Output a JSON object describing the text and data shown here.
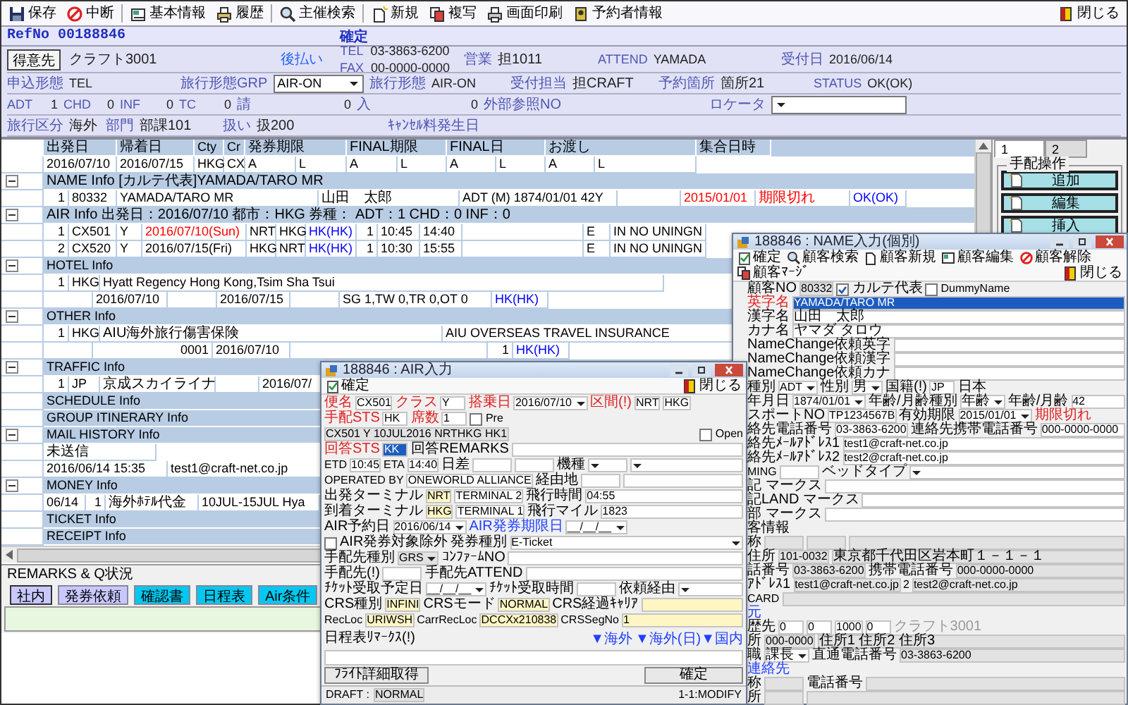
{
  "toolbar": {
    "items": [
      "保存",
      "中断",
      "基本情報",
      "履歴",
      "主催検索",
      "新規",
      "複写",
      "画面印刷",
      "予約者情報"
    ],
    "close": "閉じる"
  },
  "ref": {
    "label": "RefNo",
    "number": "00188846",
    "status": "確定"
  },
  "header": [
    [
      {
        "kind": "button",
        "text": "得意先"
      },
      {
        "kind": "value",
        "text": "クラフト3001"
      },
      {
        "kind": "link",
        "text": "後払い"
      },
      {
        "kind": "stack",
        "lines": [
          {
            "label": "TEL",
            "value": "03-3863-6200"
          },
          {
            "label": "FAX",
            "value": "00-0000-0000"
          }
        ]
      },
      {
        "kind": "field",
        "label": "営業",
        "value": "担1011"
      },
      {
        "kind": "field",
        "label": "ATTEND",
        "value": "YAMADA"
      },
      {
        "kind": "field",
        "label": "受付日",
        "value": "2016/06/14"
      }
    ],
    [
      {
        "kind": "field",
        "label": "申込形態",
        "value": "TEL"
      },
      {
        "kind": "select",
        "label": "旅行形態GRP",
        "value": "AIR-ON"
      },
      {
        "kind": "field",
        "label": "旅行形態",
        "value": "AIR-ON"
      },
      {
        "kind": "field",
        "label": "受付担当",
        "value": "担CRAFT"
      },
      {
        "kind": "field",
        "label": "予約箇所",
        "value": "箇所21"
      },
      {
        "kind": "field",
        "label": "STATUS",
        "value": "OK(OK)"
      }
    ],
    [
      {
        "kind": "count",
        "label": "ADT",
        "value": "1"
      },
      {
        "kind": "count",
        "label": "CHD",
        "value": "0"
      },
      {
        "kind": "count",
        "label": "INF",
        "value": "0"
      },
      {
        "kind": "count",
        "label": "TC",
        "value": "0"
      },
      {
        "kind": "count",
        "label": "請",
        "value": "0"
      },
      {
        "kind": "count",
        "label": "入",
        "value": "0"
      },
      {
        "kind": "label",
        "text": "外部参照NO"
      },
      {
        "kind": "select",
        "label": "ロケータ"
      }
    ],
    [
      {
        "kind": "field",
        "label": "旅行区分",
        "value": "海外"
      },
      {
        "kind": "field",
        "label": "部門",
        "value": "部課101"
      },
      {
        "kind": "field",
        "label": "扱い",
        "value": "扱200"
      },
      {
        "kind": "label",
        "text": "ｷｬﾝｾﾙ料発生日"
      }
    ]
  ],
  "grid": {
    "columns": [
      "出発日",
      "帰着日",
      "Cty",
      "Cr",
      "発券期限",
      "FINAL期限",
      "FINAL日",
      "お渡し",
      "集合日時"
    ],
    "rows": [
      {
        "kind": "dates",
        "cells": [
          "2016/07/10",
          "2016/07/15",
          "HKG",
          "CX",
          "A",
          "L",
          "A",
          "L",
          "A",
          "L",
          "A",
          "L"
        ]
      },
      {
        "kind": "section",
        "expanded": true,
        "text": "NAME Info [カルテ代表]YAMADA/TARO MR"
      },
      {
        "kind": "name",
        "cells": [
          "1",
          "80332",
          "YAMADA/TARO MR",
          "山田　太郎",
          "ADT (M) 1874/01/01 42Y",
          {
            "text": "2015/01/01",
            "color": "#ff0000"
          },
          {
            "text": "期限切れ",
            "color": "#ff0000"
          },
          {
            "text": "OK(OK)",
            "color": "#0000ff"
          }
        ]
      },
      {
        "kind": "section",
        "expanded": true,
        "text": "AIR Info 出発日：2016/07/10 都市：HKG 券種： ADT：1 CHD：0 INF：0"
      },
      {
        "kind": "flight",
        "cells": [
          "1",
          "CX501",
          "Y",
          {
            "text": "2016/07/10(Sun)",
            "color": "#ff0000"
          },
          "NRT",
          "HKG",
          {
            "text": "HK(HK)",
            "color": "#0000ff"
          },
          "1",
          "10:45",
          "14:40",
          "E",
          "IN NO UNINGN"
        ]
      },
      {
        "kind": "flight",
        "cells": [
          "2",
          "CX520",
          "Y",
          "2016/07/15(Fri)",
          "HKG",
          "NRT",
          {
            "text": "HK(HK)",
            "color": "#0000ff"
          },
          "1",
          "10:30",
          "15:55",
          "E",
          "IN NO UNINGN"
        ]
      },
      {
        "kind": "section",
        "expanded": true,
        "text": "HOTEL Info"
      },
      {
        "kind": "hotelA",
        "cells": [
          "1",
          "HKG",
          "Hyatt Regency Hong Kong,Tsim Sha Tsui"
        ]
      },
      {
        "kind": "hotelB",
        "cells": [
          "2016/07/10",
          "2016/07/15",
          "SG 1,TW 0,TR 0,OT 0",
          {
            "text": "HK(HK)",
            "color": "#0000ff"
          }
        ]
      },
      {
        "kind": "section",
        "expanded": true,
        "text": "OTHER Info"
      },
      {
        "kind": "otherA",
        "cells": [
          "1",
          "HKG",
          "AIU海外旅行傷害保険",
          "AIU OVERSEAS TRAVEL INSURANCE"
        ]
      },
      {
        "kind": "otherB",
        "cells": [
          "0001",
          "2016/07/10",
          "1",
          {
            "text": "HK(HK)",
            "color": "#0000ff"
          }
        ]
      },
      {
        "kind": "section",
        "expanded": true,
        "text": "TRAFFIC Info"
      },
      {
        "kind": "traffic",
        "cells": [
          "1",
          "JP",
          "京成スカイライナ",
          "2016/07/"
        ]
      },
      {
        "kind": "section",
        "text": "SCHEDULE Info"
      },
      {
        "kind": "section",
        "text": "GROUP ITINERARY Info"
      },
      {
        "kind": "section",
        "expanded": true,
        "text": "MAIL HISTORY Info"
      },
      {
        "kind": "mail",
        "cells": [
          "未送信"
        ]
      },
      {
        "kind": "mail2",
        "cells": [
          "2016/06/14 15:35",
          "test1@craft-net.co.jp"
        ]
      },
      {
        "kind": "section",
        "expanded": true,
        "text": "MONEY Info"
      },
      {
        "kind": "money",
        "cells": [
          "06/14",
          "1",
          "海外ﾎﾃﾙ代金",
          "10JUL-15JUL Hya"
        ]
      },
      {
        "kind": "section",
        "text": "TICKET Info"
      },
      {
        "kind": "section",
        "text": "RECEIPT Info"
      }
    ]
  },
  "remarks": {
    "title": "REMARKS & Q状況",
    "tabs": [
      {
        "label": "社内",
        "selected": true,
        "color": "#c8c8ff"
      },
      {
        "label": "発券依頼",
        "selected": false,
        "color": "#c8c8ff"
      },
      {
        "label": "確認書",
        "selected": false,
        "color": "#00c8f0"
      },
      {
        "label": "日程表",
        "selected": false,
        "color": "#00c8f0"
      },
      {
        "label": "Air条件",
        "selected": false,
        "color": "#00c8f0"
      }
    ]
  },
  "side": {
    "tabs": [
      {
        "label": "1",
        "selected": true
      },
      {
        "label": "2",
        "selected": false
      }
    ],
    "group": "手配操作",
    "buttons": [
      "追加",
      "編集",
      "挿入"
    ]
  },
  "name_dialog": {
    "title": "188846 : NAME入力(個別)",
    "toolbar": [
      "確定",
      "顧客検索",
      "顧客新規",
      "顧客編集",
      "顧客解除",
      "顧客ﾏｰｼﾞ"
    ],
    "close": "閉じる",
    "rows": [
      {
        "items": [
          {
            "kind": "label",
            "text": "顧客NO"
          },
          {
            "kind": "field",
            "value": "80332",
            "readonly": true
          },
          {
            "kind": "check",
            "text": "カルテ代表",
            "checked": true
          },
          {
            "kind": "check",
            "text": "DummyName",
            "checked": false
          }
        ]
      },
      {
        "items": [
          {
            "kind": "label",
            "text": "英字名",
            "color": "#e02020"
          },
          {
            "kind": "field",
            "value": "YAMADA/TARO MR",
            "highlighted": true
          }
        ]
      },
      {
        "items": [
          {
            "kind": "label",
            "text": "漢字名"
          },
          {
            "kind": "field",
            "value": "山田　太郎"
          }
        ]
      },
      {
        "items": [
          {
            "kind": "label",
            "text": "カナ名"
          },
          {
            "kind": "field",
            "value": "ヤマダ タロウ"
          }
        ]
      },
      {
        "items": [
          {
            "kind": "label",
            "text": "NameChange依頼英字"
          },
          {
            "kind": "field"
          }
        ]
      },
      {
        "items": [
          {
            "kind": "label",
            "text": "NameChange依頼漢字"
          },
          {
            "kind": "field"
          }
        ]
      },
      {
        "items": [
          {
            "kind": "label",
            "text": "NameChange依頼カナ"
          },
          {
            "kind": "field"
          }
        ]
      },
      {
        "items": [
          {
            "kind": "label",
            "text": "種別"
          },
          {
            "kind": "field",
            "value": "ADT",
            "dropdown": true
          },
          {
            "kind": "label",
            "text": "性別"
          },
          {
            "kind": "field",
            "value": "男",
            "dropdown": true
          },
          {
            "kind": "label",
            "text": "国籍(!)"
          },
          {
            "kind": "field",
            "value": "JP"
          },
          {
            "kind": "label",
            "text": "日本"
          }
        ]
      },
      {
        "items": [
          {
            "kind": "label",
            "text": "年月日"
          },
          {
            "kind": "field",
            "value": "1874/01/01",
            "dropdown": true
          },
          {
            "kind": "label",
            "text": "年齢/月齢種別"
          },
          {
            "kind": "field",
            "value": "年齢",
            "dropdown": true
          },
          {
            "kind": "label",
            "text": "年齢/月齢"
          },
          {
            "kind": "field",
            "value": "42"
          }
        ]
      },
      {
        "items": [
          {
            "kind": "label",
            "text": "スポートNO"
          },
          {
            "kind": "field",
            "value": "TP1234567B"
          },
          {
            "kind": "label",
            "text": "有効期限"
          },
          {
            "kind": "field",
            "value": "2015/01/01",
            "dropdown": true
          },
          {
            "kind": "label",
            "text": "期限切れ",
            "color": "#e02020"
          }
        ]
      },
      {
        "items": [
          {
            "kind": "label",
            "text": "絡先電話番号"
          },
          {
            "kind": "field",
            "value": "03-3863-6200"
          },
          {
            "kind": "label",
            "text": "連絡先携帯電話番号"
          },
          {
            "kind": "field",
            "value": "000-0000-0000"
          }
        ]
      },
      {
        "items": [
          {
            "kind": "label",
            "text": "絡先ﾒｰﾙｱﾄﾞﾚｽ1"
          },
          {
            "kind": "field",
            "value": "test1@craft-net.co.jp"
          }
        ]
      },
      {
        "items": [
          {
            "kind": "label",
            "text": "絡先ﾒｰﾙｱﾄﾞﾚｽ2"
          },
          {
            "kind": "field",
            "value": "test2@craft-net.co.jp"
          }
        ]
      },
      {
        "items": [
          {
            "kind": "label",
            "text": "MING"
          },
          {
            "kind": "field"
          },
          {
            "kind": "label",
            "text": "ベッドタイプ"
          },
          {
            "kind": "field",
            "dropdown": true
          }
        ]
      },
      {
        "items": [
          {
            "kind": "label",
            "text": "記 マークス"
          },
          {
            "kind": "area"
          }
        ]
      },
      {
        "items": [
          {
            "kind": "label",
            "text": "記LAND マークス"
          },
          {
            "kind": "area"
          }
        ]
      },
      {
        "items": [
          {
            "kind": "label",
            "text": "部 マークス"
          },
          {
            "kind": "area"
          }
        ]
      },
      {
        "items": [
          {
            "kind": "label",
            "text": "客情報"
          }
        ]
      },
      {
        "items": [
          {
            "kind": "label",
            "text": "称"
          },
          {
            "kind": "field",
            "readonly": true
          },
          {
            "kind": "field",
            "readonly": true
          },
          {
            "kind": "field",
            "readonly": true
          }
        ]
      },
      {
        "items": [
          {
            "kind": "label",
            "text": "住所"
          },
          {
            "kind": "field",
            "value": "101-0032",
            "readonly": true
          },
          {
            "kind": "field",
            "value": "東京都千代田区岩本町１－１－１",
            "readonly": true
          }
        ]
      },
      {
        "items": [
          {
            "kind": "label",
            "text": "話番号"
          },
          {
            "kind": "field",
            "value": "03-3863-6200",
            "readonly": true
          },
          {
            "kind": "label",
            "text": "携帯電話番号"
          },
          {
            "kind": "field",
            "value": "000-0000-0000",
            "readonly": true
          }
        ]
      },
      {
        "items": [
          {
            "kind": "label",
            "text": "ｱﾄﾞﾚｽ1"
          },
          {
            "kind": "field",
            "value": "test1@craft-net.co.jp",
            "readonly": true
          },
          {
            "kind": "label",
            "text": "2"
          },
          {
            "kind": "field",
            "value": "test2@craft-net.co.jp",
            "readonly": true
          }
        ]
      },
      {
        "items": [
          {
            "kind": "label",
            "text": "CARD"
          },
          {
            "kind": "field",
            "readonly": true
          }
        ]
      },
      {
        "items": [
          {
            "kind": "label",
            "text": "元",
            "color": "#2040ff"
          }
        ]
      },
      {
        "items": [
          {
            "kind": "label",
            "text": "歴先"
          },
          {
            "kind": "field",
            "value": "0"
          },
          {
            "kind": "field",
            "value": "0"
          },
          {
            "kind": "field",
            "value": "1000"
          },
          {
            "kind": "field",
            "value": "0"
          },
          {
            "kind": "label",
            "text": "クラフト3001",
            "color": "#9a9a9a"
          }
        ]
      },
      {
        "items": [
          {
            "kind": "label",
            "text": "所"
          },
          {
            "kind": "field",
            "value": "000-0000",
            "readonly": true
          },
          {
            "kind": "field",
            "value": "住所1 住所2 住所3",
            "readonly": true
          }
        ]
      },
      {
        "items": [
          {
            "kind": "label",
            "text": "職"
          },
          {
            "kind": "field",
            "value": "課長",
            "dropdown": true
          },
          {
            "kind": "label",
            "text": "直通電話番号"
          },
          {
            "kind": "field",
            "value": "03-3863-6200",
            "readonly": true
          }
        ]
      },
      {
        "items": [
          {
            "kind": "label",
            "text": "連絡先",
            "color": "#2040ff"
          }
        ]
      },
      {
        "items": [
          {
            "kind": "label",
            "text": "称"
          },
          {
            "kind": "field",
            "readonly": true
          },
          {
            "kind": "label",
            "text": "電話番号"
          },
          {
            "kind": "field",
            "readonly": true
          }
        ]
      },
      {
        "items": [
          {
            "kind": "label",
            "text": "所"
          },
          {
            "kind": "field",
            "readonly": true
          },
          {
            "kind": "field",
            "readonly": true
          }
        ]
      }
    ]
  },
  "air_dialog": {
    "title": "188846 : AIR入力",
    "toolbar": [
      "確定"
    ],
    "close": "閉じる",
    "rows": [
      {
        "items": [
          {
            "kind": "label",
            "text": "便名",
            "color": "#e02020"
          },
          {
            "kind": "field",
            "value": "CX501"
          },
          {
            "kind": "label",
            "text": "クラス",
            "color": "#e02020"
          },
          {
            "kind": "field",
            "value": "Y"
          },
          {
            "kind": "label",
            "text": "搭乗日",
            "color": "#e02020"
          },
          {
            "kind": "field",
            "value": "2016/07/10",
            "dropdown": true
          },
          {
            "kind": "label",
            "text": "区間(!)",
            "color": "#e02020"
          },
          {
            "kind": "field",
            "value": "NRT"
          },
          {
            "kind": "field",
            "value": "HKG"
          },
          {
            "kind": "label",
            "text": "手配STS",
            "color": "#e02020"
          },
          {
            "kind": "field",
            "value": "HK"
          },
          {
            "kind": "label",
            "text": "席数",
            "color": "#e02020"
          },
          {
            "kind": "field",
            "value": "1"
          },
          {
            "kind": "check",
            "text": "Pre",
            "checked": false
          }
        ]
      },
      {
        "items": [
          {
            "kind": "field",
            "value": "CX501 Y 10JUL2016 NRTHKG HK1",
            "readonly": true
          }
        ],
        "end": [
          {
            "kind": "check",
            "text": "Open",
            "checked": false
          }
        ]
      },
      {
        "items": [
          {
            "kind": "label",
            "text": "回答STS",
            "color": "#e02020"
          },
          {
            "kind": "field",
            "value": "KK",
            "highlighted": true
          },
          {
            "kind": "label",
            "text": "回答REMARKS"
          },
          {
            "kind": "field"
          }
        ]
      },
      {
        "items": [
          {
            "kind": "label",
            "text": "ETD"
          },
          {
            "kind": "field",
            "value": "10:45"
          },
          {
            "kind": "label",
            "text": "ETA"
          },
          {
            "kind": "field",
            "value": "14:40"
          },
          {
            "kind": "label",
            "text": "日差"
          },
          {
            "kind": "field"
          },
          {
            "kind": "field"
          },
          {
            "kind": "label",
            "text": "機種"
          },
          {
            "kind": "field",
            "dropdown": true
          },
          {
            "kind": "field",
            "dropdown": true
          }
        ]
      },
      {
        "items": [
          {
            "kind": "label",
            "text": "OPERATED BY"
          },
          {
            "kind": "field",
            "value": "ONEWORLD ALLIANCE"
          },
          {
            "kind": "label",
            "text": "経由地"
          },
          {
            "kind": "field"
          },
          {
            "kind": "field"
          }
        ]
      },
      {
        "items": [
          {
            "kind": "label",
            "text": "出発ターミナル"
          },
          {
            "kind": "field",
            "value": "NRT",
            "color": "#fff6c4"
          },
          {
            "kind": "field",
            "value": "TERMINAL 2"
          },
          {
            "kind": "label",
            "text": "飛行時間"
          },
          {
            "kind": "field",
            "value": "04:55"
          }
        ]
      },
      {
        "items": [
          {
            "kind": "label",
            "text": "到着ターミナル"
          },
          {
            "kind": "field",
            "value": "HKG",
            "color": "#fff6c4"
          },
          {
            "kind": "field",
            "value": "TERMINAL 1"
          },
          {
            "kind": "label",
            "text": "飛行マイル"
          },
          {
            "kind": "field",
            "value": "1823"
          }
        ]
      },
      {
        "items": [
          {
            "kind": "label",
            "text": "AIR予約日"
          },
          {
            "kind": "field",
            "value": "2016/06/14",
            "dropdown": true
          },
          {
            "kind": "label",
            "text": "AIR発券期限日",
            "color": "#2040ff"
          },
          {
            "kind": "field",
            "value": "__/__/__",
            "dropdown": true
          },
          {
            "kind": "check",
            "text": "AIR発券対象除外",
            "checked": false
          },
          {
            "kind": "label",
            "text": "発券種別"
          },
          {
            "kind": "field",
            "value": "E-Ticket",
            "dropdown": true
          }
        ]
      },
      {
        "items": [
          {
            "kind": "label",
            "text": "手配先種別"
          },
          {
            "kind": "field",
            "value": "GRS",
            "readonly": true,
            "dropdown": true
          },
          {
            "kind": "label",
            "text": "ｺﾝﾌｧｰﾑNO"
          },
          {
            "kind": "field"
          }
        ]
      },
      {
        "items": [
          {
            "kind": "label",
            "text": "手配先(!)"
          },
          {
            "kind": "field"
          },
          {
            "kind": "label",
            "text": "手配先ATTEND"
          },
          {
            "kind": "field"
          }
        ]
      },
      {
        "items": [
          {
            "kind": "label",
            "text": "ﾁｹｯﾄ受取予定日"
          },
          {
            "kind": "field",
            "value": "__/__/__",
            "dropdown": true
          },
          {
            "kind": "label",
            "text": "ﾁｹｯﾄ受取時間"
          },
          {
            "kind": "field"
          },
          {
            "kind": "label",
            "text": "依頼経由"
          },
          {
            "kind": "field",
            "dropdown": true
          }
        ]
      },
      {
        "items": [
          {
            "kind": "label",
            "text": "CRS種別"
          },
          {
            "kind": "field",
            "value": "INFINI",
            "color": "#fff6c4"
          },
          {
            "kind": "label",
            "text": "CRSモード"
          },
          {
            "kind": "field",
            "value": "NORMAL",
            "color": "#fff6c4"
          },
          {
            "kind": "label",
            "text": "CRS経過ｷｬﾘｱ"
          },
          {
            "kind": "field",
            "color": "#fff6c4"
          }
        ]
      },
      {
        "items": [
          {
            "kind": "label",
            "text": "RecLoc"
          },
          {
            "kind": "field",
            "value": "URIWSH",
            "color": "#fff6c4"
          },
          {
            "kind": "label",
            "text": "CarrRecLoc"
          },
          {
            "kind": "field",
            "value": "DCCXx210838",
            "color": "#fff6c4"
          },
          {
            "kind": "label",
            "text": "CRSSegNo"
          },
          {
            "kind": "field",
            "value": "1",
            "color": "#fff6c4"
          }
        ]
      },
      {
        "items": [
          {
            "kind": "label",
            "text": "日程表ﾘﾏｰｸｽ(!)"
          }
        ],
        "end": [
          {
            "kind": "link",
            "text": "▼海外"
          },
          {
            "kind": "link",
            "text": "▼海外(日)▼国内"
          }
        ]
      },
      {
        "items": [
          {
            "kind": "area"
          }
        ]
      },
      {
        "items": [
          {
            "kind": "button",
            "text": "ﾌﾗｲﾄ詳細取得"
          }
        ],
        "end": [
          {
            "kind": "button",
            "text": "確定"
          }
        ]
      }
    ],
    "status_bar": {
      "items": [
        {
          "kind": "label",
          "text": "DRAFT :"
        },
        {
          "kind": "field",
          "value": "NORMAL",
          "readonly": true
        }
      ],
      "end": [
        {
          "kind": "label",
          "text": "1-1:MODIFY"
        }
      ]
    }
  }
}
